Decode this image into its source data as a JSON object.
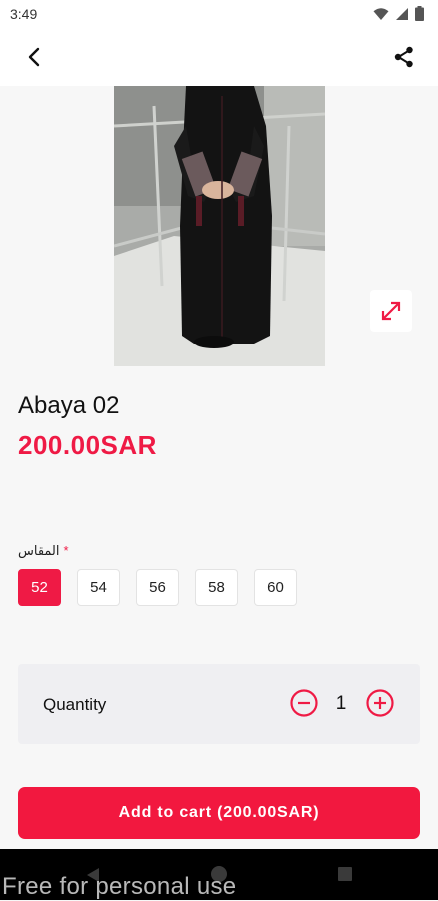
{
  "status": {
    "time": "3:49"
  },
  "colors": {
    "accent": "#ef1a45",
    "background": "#f7f7f7"
  },
  "icons": {
    "back": "arrow-left-icon",
    "share": "share-icon",
    "expand": "expand-icon",
    "minus": "minus-circle-icon",
    "plus": "plus-circle-icon"
  },
  "product": {
    "title": "Abaya 02",
    "price": "200.00SAR"
  },
  "size_option": {
    "label": "المقاس",
    "required_mark": "*",
    "selected": "52",
    "values": [
      "52",
      "54",
      "56",
      "58",
      "60"
    ]
  },
  "quantity": {
    "label": "Quantity",
    "value": "1"
  },
  "cart": {
    "button_label": "Add to cart (200.00SAR)"
  },
  "watermark": "Free for personal use"
}
